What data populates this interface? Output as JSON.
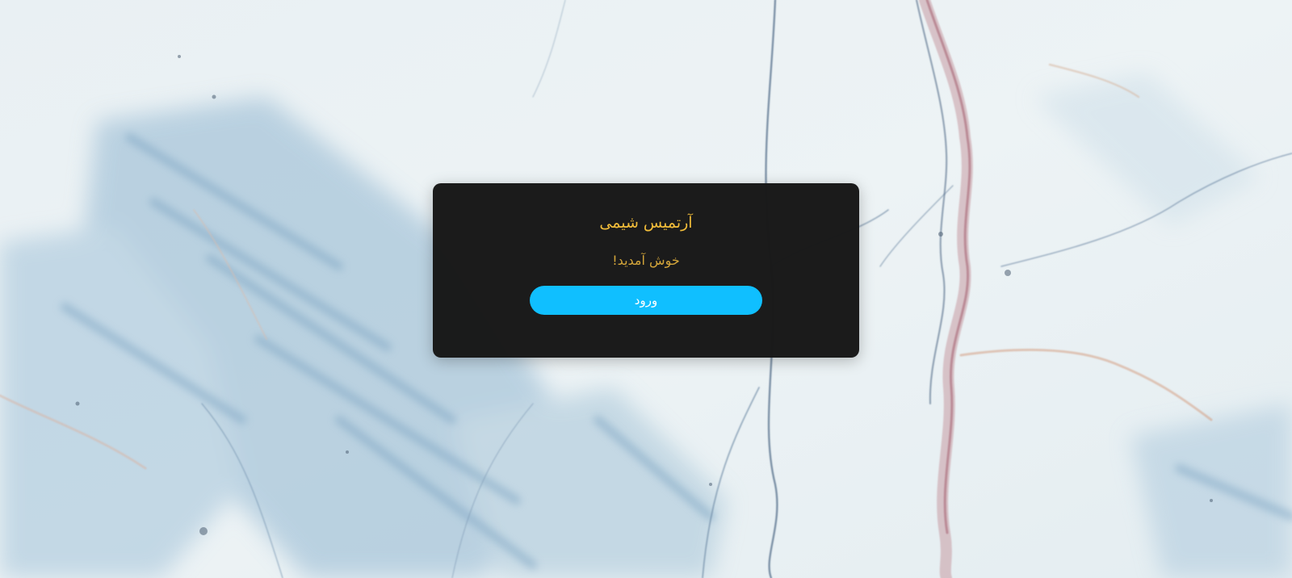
{
  "background": {
    "image": "marble-texture",
    "colors": {
      "base": "#e6eef1",
      "blue_vein": "#8fb4cf",
      "dark_vein": "#4c6a86",
      "red_vein": "#c69aa0"
    }
  },
  "card": {
    "brand_title": "آرتمیس شیمی",
    "welcome_text": "خوش آمدید!",
    "login_button_label": "ورود",
    "colors": {
      "card_bg": "#181818",
      "brand": "#f2bd3a",
      "welcome": "#d3a53a",
      "button": "#10bfff",
      "button_text": "#ffffff"
    }
  }
}
